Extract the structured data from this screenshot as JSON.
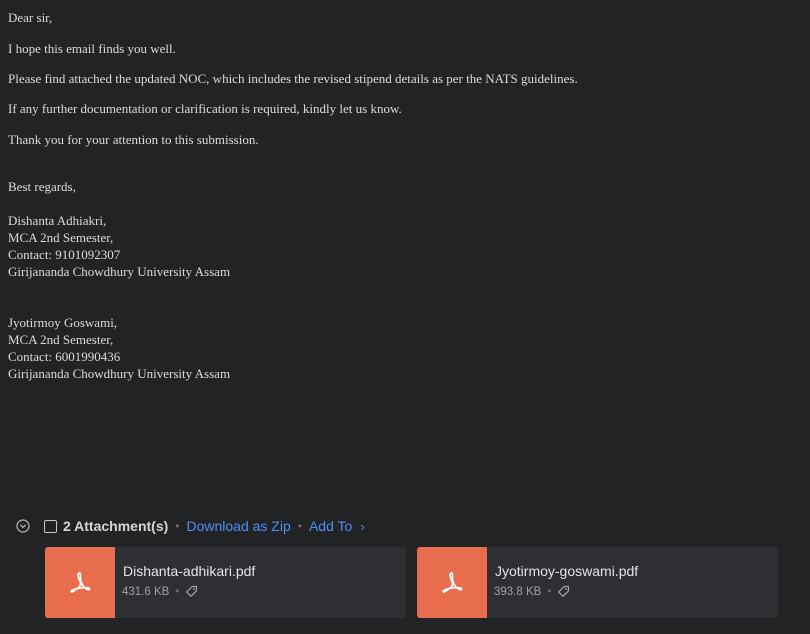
{
  "email": {
    "greeting": "Dear sir,",
    "para1": "I hope this email finds you well.",
    "para2": "Please find attached the updated NOC, which includes the revised stipend details as per the NATS guidelines.",
    "para3": "If any further documentation or clarification is required, kindly let us know.",
    "para4": "Thank you for your attention to this submission.",
    "closing": "Best regards,",
    "sender1": {
      "name": "Dishanta Adhiakri,",
      "course": "MCA 2nd Semester,",
      "contact": "Contact: 9101092307",
      "university": "Girijananda Chowdhury University Assam"
    },
    "sender2": {
      "name": "Jyotirmoy Goswami,",
      "course": "MCA 2nd Semester,",
      "contact": "Contact: 6001990436",
      "university": "Girijananda Chowdhury University Assam"
    }
  },
  "attachments": {
    "count_label": "2 Attachment(s)",
    "download_zip_label": "Download as Zip",
    "add_to_label": "Add To",
    "items": [
      {
        "filename": "Dishanta-adhikari.pdf",
        "size": "431.6 KB",
        "icon": "pdf-icon"
      },
      {
        "filename": "Jyotirmoy-goswami.pdf",
        "size": "393.8 KB",
        "icon": "pdf-icon"
      }
    ]
  },
  "colors": {
    "background": "#222325",
    "accent": "#4f8ff7",
    "pdf_thumb": "#e86d4f",
    "card": "#2e2f33"
  }
}
